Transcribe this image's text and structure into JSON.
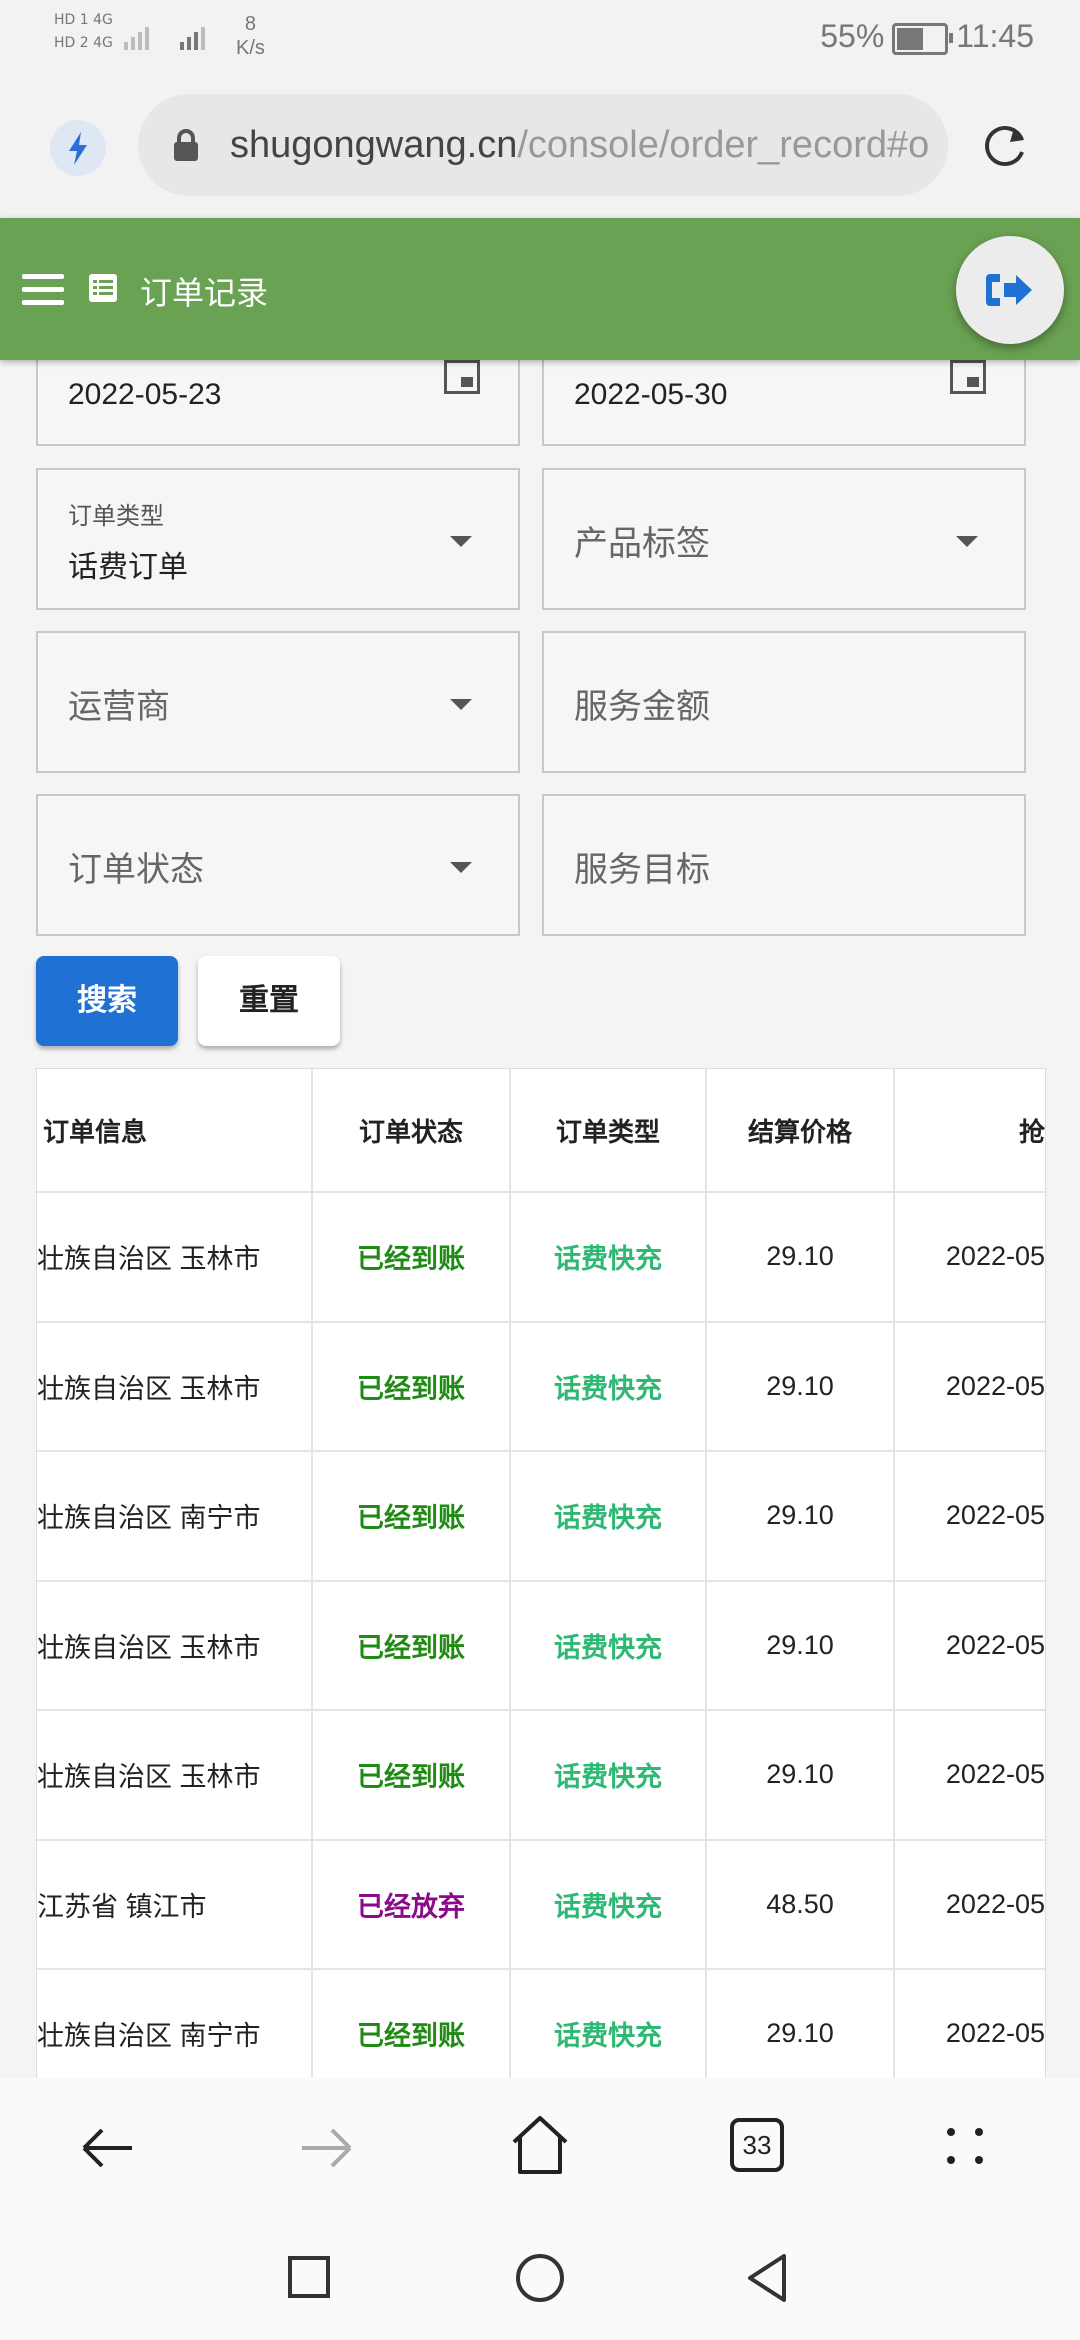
{
  "status_bar": {
    "sim1": "HD 1",
    "sim2": "HD 2",
    "net1": "4G",
    "net2": "4G",
    "speed_value": "8",
    "speed_unit": "K/s",
    "battery": "55%",
    "time": "11:45"
  },
  "browser": {
    "url_host": "shugongwang.cn",
    "url_path": "/console/order_record#ordi",
    "tab_count": "33"
  },
  "header": {
    "title": "订单记录"
  },
  "filters": {
    "start_date": "2022-05-23",
    "end_date": "2022-05-30",
    "order_type_label": "订单类型",
    "order_type_value": "话费订单",
    "product_tag_placeholder": "产品标签",
    "carrier_placeholder": "运营商",
    "service_amount_placeholder": "服务金额",
    "order_status_placeholder": "订单状态",
    "service_target_placeholder": "服务目标",
    "search_label": "搜索",
    "reset_label": "重置"
  },
  "table": {
    "headers": [
      "订单信息",
      "订单状态",
      "订单类型",
      "结算价格",
      "抢"
    ],
    "rows": [
      {
        "info": "壮族自治区 玉林市",
        "status": "已经到账",
        "status_kind": "ok",
        "type": "话费快充",
        "price": "29.10",
        "time": "2022-05"
      },
      {
        "info": "壮族自治区 玉林市",
        "status": "已经到账",
        "status_kind": "ok",
        "type": "话费快充",
        "price": "29.10",
        "time": "2022-05"
      },
      {
        "info": "壮族自治区 南宁市",
        "status": "已经到账",
        "status_kind": "ok",
        "type": "话费快充",
        "price": "29.10",
        "time": "2022-05"
      },
      {
        "info": "壮族自治区 玉林市",
        "status": "已经到账",
        "status_kind": "ok",
        "type": "话费快充",
        "price": "29.10",
        "time": "2022-05"
      },
      {
        "info": "壮族自治区 玉林市",
        "status": "已经到账",
        "status_kind": "ok",
        "type": "话费快充",
        "price": "29.10",
        "time": "2022-05"
      },
      {
        "info": "江苏省 镇江市",
        "status": "已经放弃",
        "status_kind": "drop",
        "type": "话费快充",
        "price": "48.50",
        "time": "2022-05"
      },
      {
        "info": "壮族自治区 南宁市",
        "status": "已经到账",
        "status_kind": "ok",
        "type": "话费快充",
        "price": "29.10",
        "time": "2022-05"
      }
    ]
  },
  "colors": {
    "header_bg": "#6aa253",
    "search_button": "#1f72d4",
    "status_ok": "#1f8a14",
    "status_abandoned": "#8a0a8a",
    "type_text": "#2fb873"
  },
  "icons": {
    "bolt": "lightning-icon",
    "lock": "lock-icon",
    "reload": "reload-icon",
    "menu": "menu-icon",
    "list": "list-icon",
    "logout": "logout-icon",
    "calendar": "calendar-icon",
    "back": "back-arrow-icon",
    "forward": "forward-arrow-icon",
    "home": "home-icon",
    "tabs": "tabs-icon",
    "more": "more-icon"
  }
}
